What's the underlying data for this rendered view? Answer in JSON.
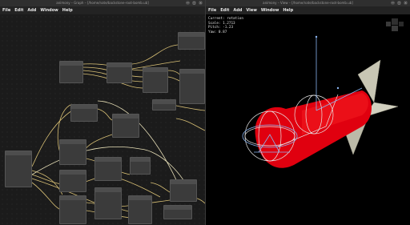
{
  "left_window": {
    "title": "animony – Graph – [/home/nate/backstone-root-bomb.ub]",
    "menu": [
      "File",
      "Edit",
      "Add",
      "Window",
      "Help"
    ],
    "window_buttons": [
      "—",
      "□",
      "×"
    ]
  },
  "right_window": {
    "title": "animony – View – [/home/nate/backstone-root-bomb.ub]",
    "menu": [
      "File",
      "Edit",
      "Add",
      "View",
      "Window",
      "Help"
    ],
    "window_buttons": [
      "—",
      "□",
      "×"
    ],
    "hud": {
      "mode": "Current: rotation",
      "scale": "Scale: 1.2713",
      "pitch": "Pitch: -1.23",
      "yaw": "Yaw: 0.87"
    }
  },
  "colors": {
    "wire": "#e3c97a",
    "wire_light": "#e8e0b8",
    "rocket_body": "#e0000f",
    "fins": "#c8c6b4",
    "gizmo": "#8ab4f0",
    "node_bg": "#3b3b3b"
  }
}
